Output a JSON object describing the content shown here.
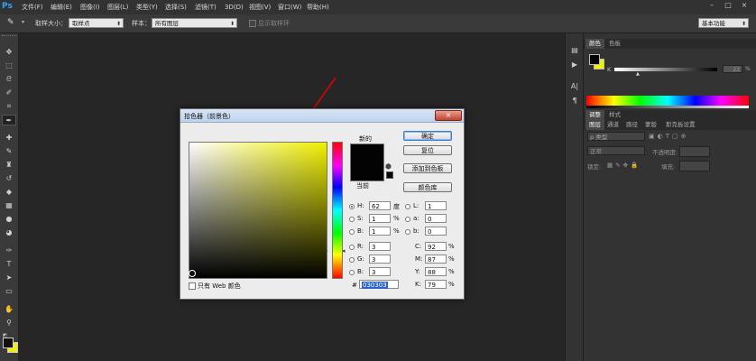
{
  "app": {
    "logo": "Ps",
    "menu": [
      "文件(F)",
      "编辑(E)",
      "图像(I)",
      "图层(L)",
      "类型(Y)",
      "选择(S)",
      "滤镜(T)",
      "3D(D)",
      "视图(V)",
      "窗口(W)",
      "帮助(H)"
    ],
    "window_buttons": [
      "–",
      "□",
      "×"
    ]
  },
  "options_bar": {
    "sample_size_label": "取样大小：",
    "sample_size_value": "取样点",
    "sample_label": "样本：",
    "sample_value": "所有图层",
    "show_ring_label": "显示取样环",
    "workspace": "基本功能"
  },
  "color_panel": {
    "tabs": [
      "颜色",
      "色板"
    ],
    "k_label": "K",
    "k_value": "23",
    "k_unit": "%"
  },
  "adjust_panel": {
    "tabs": [
      "调整",
      "样式"
    ]
  },
  "layers_panel": {
    "tabs": [
      "图层",
      "通道",
      "路径",
      "蒙版",
      "斯克板设置"
    ],
    "kind_label": "ρ 类型",
    "blend_mode": "正常",
    "opacity_label": "不透明度:",
    "lock_label": "锁定:",
    "fill_label": "填充:"
  },
  "dialog": {
    "title": "拾色器（前景色）",
    "close": "×",
    "new_label": "新的",
    "current_label": "当前",
    "buttons": {
      "ok": "确定",
      "reset": "复位",
      "add_swatch": "添加到色板",
      "color_libraries": "颜色库"
    },
    "fields": {
      "H": {
        "label": "H:",
        "value": "62",
        "unit": "度"
      },
      "S": {
        "label": "S:",
        "value": "1",
        "unit": "%"
      },
      "B": {
        "label": "B:",
        "value": "1",
        "unit": "%"
      },
      "R": {
        "label": "R:",
        "value": "3"
      },
      "G": {
        "label": "G:",
        "value": "3"
      },
      "Bl": {
        "label": "B:",
        "value": "3"
      },
      "L": {
        "label": "L:",
        "value": "1"
      },
      "a": {
        "label": "a:",
        "value": "0"
      },
      "b": {
        "label": "b:",
        "value": "0"
      },
      "C": {
        "label": "C:",
        "value": "92",
        "unit": "%"
      },
      "M": {
        "label": "M:",
        "value": "87",
        "unit": "%"
      },
      "Y": {
        "label": "Y:",
        "value": "88",
        "unit": "%"
      },
      "K": {
        "label": "K:",
        "value": "79",
        "unit": "%"
      }
    },
    "hex_label": "#",
    "hex_value": "030303",
    "web_only_label": "只有 Web 颜色",
    "base_hue_color": "#f0f000"
  },
  "colors": {
    "foreground": "#030303",
    "background": "#f0f000",
    "annotation_arrow": "#e00000"
  }
}
